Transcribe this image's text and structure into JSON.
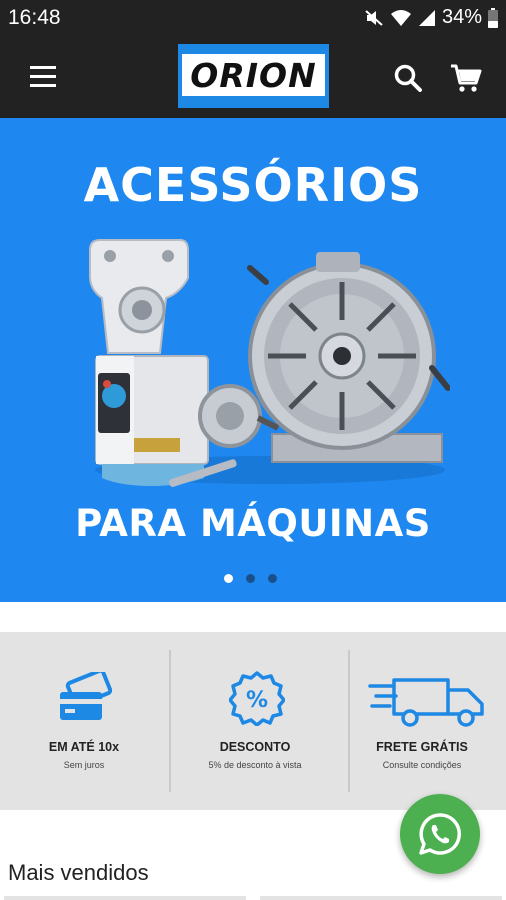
{
  "status_bar": {
    "time": "16:48",
    "battery": "34%",
    "icons": [
      "mute-icon",
      "wifi-icon",
      "signal-icon",
      "battery-icon"
    ]
  },
  "app_bar": {
    "logo": "ORION",
    "icons": [
      "menu-icon",
      "search-icon",
      "cart-icon"
    ],
    "colors": {
      "bar": "#222222",
      "logo_blue": "#1e88e5"
    }
  },
  "banner": {
    "title": "ACESSÓRIOS",
    "subtitle": "PARA MÁQUINAS",
    "slide_count": 3,
    "active_slide": 1,
    "background": "#1e88f0"
  },
  "benefits": [
    {
      "icon": "credit-card-icon",
      "title": "EM ATÉ 10x",
      "subtitle": "Sem juros"
    },
    {
      "icon": "discount-badge-icon",
      "title": "DESCONTO",
      "subtitle": "5% de desconto à vista"
    },
    {
      "icon": "delivery-truck-icon",
      "title": "FRETE GRÁTIS",
      "subtitle": "Consulte condições"
    }
  ],
  "section": {
    "title": "Mais vendidos"
  },
  "whatsapp": {
    "icon": "whatsapp-icon",
    "color": "#4caf50"
  }
}
